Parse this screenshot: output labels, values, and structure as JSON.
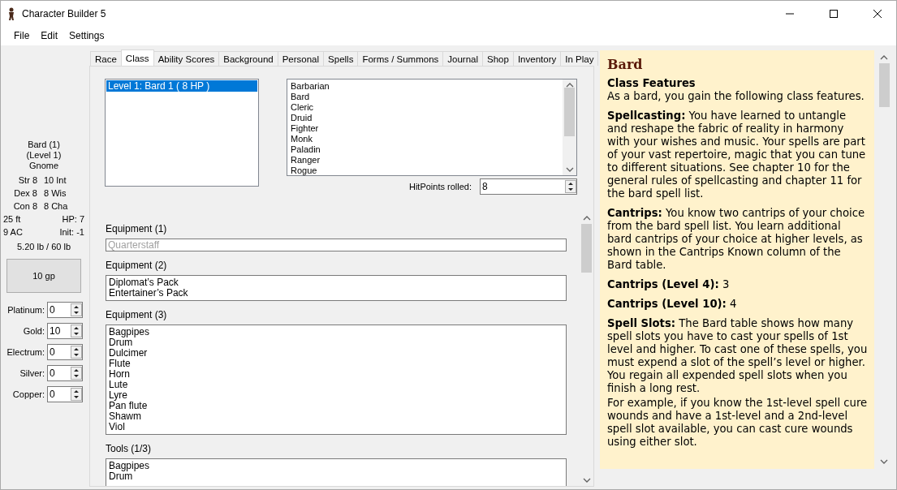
{
  "window": {
    "title": "Character Builder 5"
  },
  "menu": [
    "File",
    "Edit",
    "Settings"
  ],
  "character": {
    "summary": [
      "Bard (1)",
      "(Level 1)",
      "Gnome"
    ],
    "abilities": [
      {
        "left": "Str 8",
        "right": "10 Int"
      },
      {
        "left": "Dex 8",
        "right": "8 Wis"
      },
      {
        "left": "Con 8",
        "right": "8 Cha"
      }
    ],
    "stats": [
      {
        "left": "25 ft",
        "right": "HP: 7"
      },
      {
        "left": "9 AC",
        "right": "Init: -1"
      }
    ],
    "weight": "5.20 lb / 60 lb",
    "money": "10 gp",
    "coins": [
      {
        "label": "Platinum:",
        "value": "0"
      },
      {
        "label": "Gold:",
        "value": "10"
      },
      {
        "label": "Electrum:",
        "value": "0"
      },
      {
        "label": "Silver:",
        "value": "0"
      },
      {
        "label": "Copper:",
        "value": "0"
      }
    ]
  },
  "tabs": [
    {
      "label": "Race",
      "selected": false
    },
    {
      "label": "Class",
      "selected": true
    },
    {
      "label": "Ability Scores",
      "selected": false
    },
    {
      "label": "Background",
      "selected": false
    },
    {
      "label": "Personal",
      "selected": false
    },
    {
      "label": "Spells",
      "selected": false
    },
    {
      "label": "Forms / Summons",
      "selected": false
    },
    {
      "label": "Journal",
      "selected": false
    },
    {
      "label": "Shop",
      "selected": false
    },
    {
      "label": "Inventory",
      "selected": false
    },
    {
      "label": "In Play",
      "selected": false
    }
  ],
  "levels": [
    {
      "label": "Level 1: Bard 1 ( 8 HP )",
      "selected": true
    }
  ],
  "classes": [
    "Barbarian",
    "Bard",
    "Cleric",
    "Druid",
    "Fighter",
    "Monk",
    "Paladin",
    "Ranger",
    "Rogue"
  ],
  "hit_points": {
    "label": "HitPoints rolled:",
    "value": "8"
  },
  "equipment": [
    {
      "kind": "field",
      "label": "Equipment (1)",
      "placeholder": "Quarterstaff"
    },
    {
      "kind": "list",
      "label": "Equipment (2)",
      "items": [
        "Diplomat’s Pack",
        "Entertainer’s Pack"
      ]
    },
    {
      "kind": "list",
      "label": "Equipment (3)",
      "items": [
        "Bagpipes",
        "Drum",
        "Dulcimer",
        "Flute",
        "Horn",
        "Lute",
        "Lyre",
        "Pan flute",
        "Shawm",
        "Viol"
      ]
    },
    {
      "kind": "list",
      "label": "Tools (1/3)",
      "items": [
        "Bagpipes",
        "Drum"
      ]
    }
  ],
  "description": {
    "title": "Bard",
    "heading": "Class Features",
    "paragraphs": [
      "As a bard, you gain the following class features.",
      "**Spellcasting:** You have learned to untangle and reshape the fabric of reality in harmony with your wishes and music. Your spells are part of your vast repertoire, magic that you can tune to different situations. See chapter 10 for the general rules of spellcasting and chapter 11 for the bard spell list.",
      "**Cantrips:** You know two cantrips of your choice from the bard spell list. You learn additional bard cantrips of your choice at higher levels, as shown in the Cantrips Known column of the Bard table.",
      "**Cantrips (Level 4):** 3",
      "**Cantrips (Level 10):** 4",
      "**Spell Slots:** The Bard table shows how many spell slots you have to cast your spells of 1st level and higher. To cast one of these spells, you must expend a slot of the spell’s level or higher. You regain all expended spell slots when you finish a long rest.",
      "For example, if you know the 1st-level spell cure wounds and have a 1st-level and a 2nd-level spell slot available, you can cast cure wounds using either slot."
    ]
  }
}
